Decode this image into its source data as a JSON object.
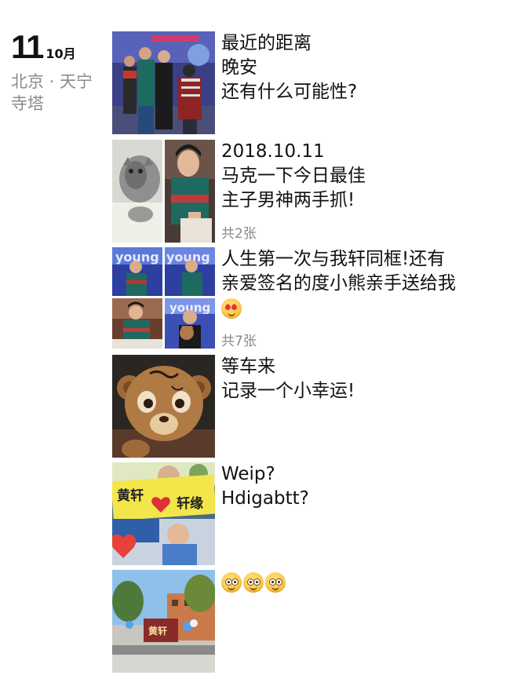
{
  "date": {
    "day": "11",
    "month": "10月"
  },
  "location": {
    "line1": "北京 · 天宁",
    "line2": "寺塔"
  },
  "posts": [
    {
      "lines": [
        "最近的距离",
        "晚安",
        "还有什么可能性?"
      ]
    },
    {
      "lines": [
        "2018.10.11",
        "马克一下今日最佳",
        "主子男神两手抓!"
      ],
      "count": "共2张"
    },
    {
      "lines": [
        "人生第一次与我轩同框!还有",
        "亲爱签名的度小熊亲手送给我"
      ],
      "count": "共7张",
      "emoji": "heart-eyes-emoji"
    },
    {
      "lines": [
        "等车来",
        "记录一个小幸运!"
      ]
    },
    {
      "lines": [
        "Weip?",
        "Hdigabtt?"
      ]
    },
    {
      "emoji": [
        "flushed-face-emoji",
        "flushed-face-emoji",
        "flushed-face-emoji"
      ]
    }
  ],
  "colors": {
    "text": "#111111",
    "muted": "#8a8a8a",
    "background": "#ffffff"
  }
}
